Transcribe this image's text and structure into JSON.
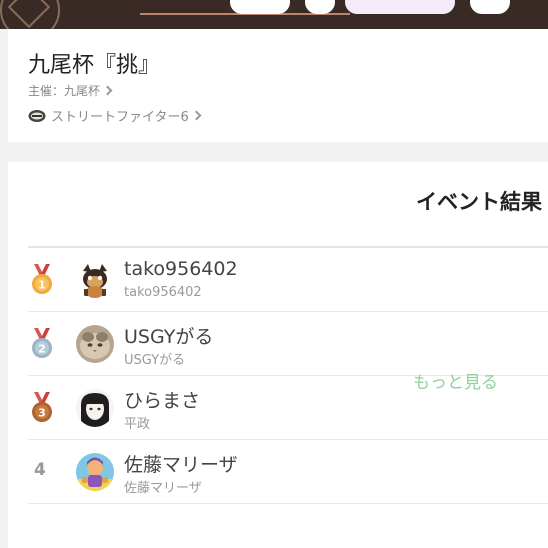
{
  "event": {
    "title": "九尾杯『挑』",
    "organizer": "主催：九尾杯",
    "game": "ストリートファイター6",
    "game_icon": "sf6-game-icon"
  },
  "results": {
    "title": "イベント結果",
    "entries": [
      {
        "rank": "1",
        "medal": "gold-medal-icon",
        "name": "tako956402",
        "sub": "tako956402",
        "avatar": "tanuki-avatar"
      },
      {
        "rank": "2",
        "medal": "silver-medal-icon",
        "name": "USGYがる",
        "sub": "USGYがる",
        "avatar": "cat-photo-avatar"
      },
      {
        "rank": "3",
        "medal": "bronze-medal-icon",
        "name": "ひらまさ",
        "sub": "平政",
        "avatar": "girl-drawing-avatar"
      },
      {
        "rank": "4",
        "medal": null,
        "name": "佐藤マリーザ",
        "sub": "佐藤マリーザ",
        "avatar": "marisa-avatar"
      }
    ],
    "more_label": "もっと見る"
  },
  "colors": {
    "gold": "#f2a93b",
    "silver": "#9bb3c4",
    "bronze": "#b0632d",
    "medal_ribbon": "#d9534f",
    "accent_link": "#8fd19e",
    "banner_bg": "#3a2a26"
  }
}
